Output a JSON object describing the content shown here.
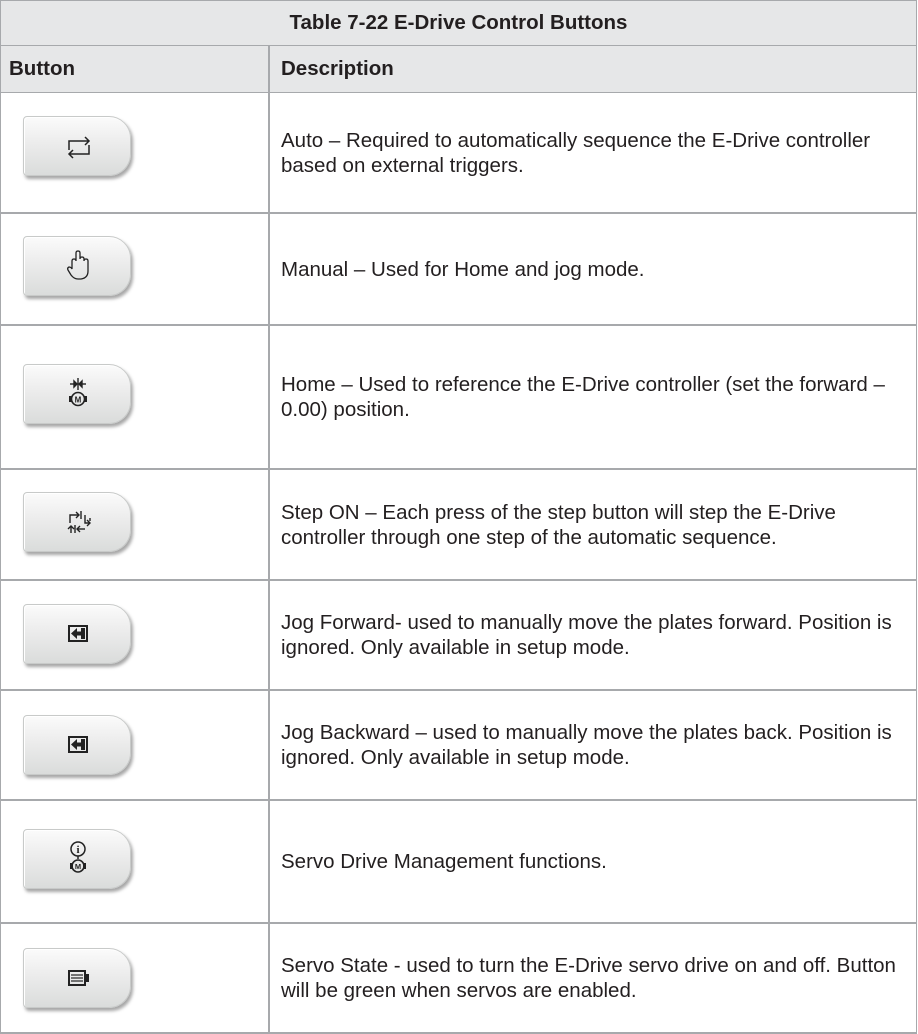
{
  "table": {
    "title": "Table 7-22 E-Drive Control Buttons",
    "headers": {
      "button": "Button",
      "description": "Description"
    },
    "rows": [
      {
        "icon": "auto-cycle-icon",
        "description": "Auto – Required to automatically sequence the E-Drive controller based on external triggers."
      },
      {
        "icon": "hand-icon",
        "description": "Manual – Used for Home and jog mode."
      },
      {
        "icon": "home-motor-icon",
        "description": "Home – Used to reference the E-Drive controller (set the forward – 0.00) position."
      },
      {
        "icon": "step-cycle-icon",
        "description": "Step ON – Each press of the step button will step the E-Drive controller through one step of the automatic sequence."
      },
      {
        "icon": "jog-forward-icon",
        "description": "Jog Forward- used to manually move the plates forward. Position is ignored. Only available in setup mode."
      },
      {
        "icon": "jog-backward-icon",
        "description": "Jog Backward – used to manually move the plates back. Position is ignored. Only available in setup mode."
      },
      {
        "icon": "servo-info-motor-icon",
        "description": "Servo Drive Management functions."
      },
      {
        "icon": "battery-icon",
        "description": "Servo State - used to turn the E-Drive servo drive on and off. Button will be green when servos are enabled."
      }
    ]
  }
}
